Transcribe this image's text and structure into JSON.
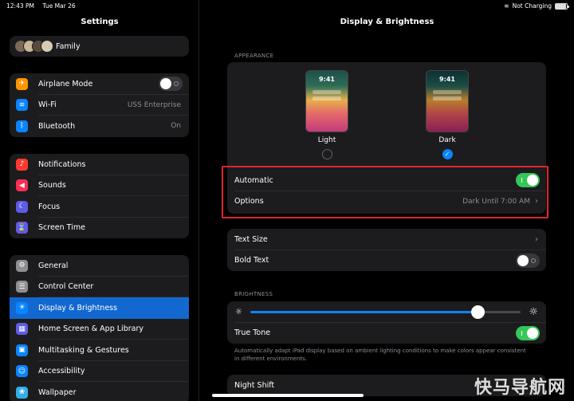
{
  "status": {
    "time": "12:43 PM",
    "date": "Tue Mar 26",
    "charging": "Not Charging",
    "battery_percent": 90
  },
  "sidebar": {
    "title": "Settings",
    "family": "Family",
    "group1": [
      {
        "label": "Airplane Mode",
        "icon": "airplane-icon",
        "color": "#ff9500",
        "glyph": "✈"
      },
      {
        "label": "Wi-Fi",
        "value": "USS Enterprise",
        "icon": "wifi-icon",
        "color": "#0a84ff",
        "glyph": "≋"
      },
      {
        "label": "Bluetooth",
        "value": "On",
        "icon": "bluetooth-icon",
        "color": "#0a84ff",
        "glyph": "ᛒ"
      }
    ],
    "group2": [
      {
        "label": "Notifications",
        "icon": "bell-icon",
        "color": "#ff3b30",
        "glyph": "♪"
      },
      {
        "label": "Sounds",
        "icon": "speaker-icon",
        "color": "#ff2d55",
        "glyph": "◀"
      },
      {
        "label": "Focus",
        "icon": "moon-icon",
        "color": "#5e5ce6",
        "glyph": "☾"
      },
      {
        "label": "Screen Time",
        "icon": "hourglass-icon",
        "color": "#5e5ce6",
        "glyph": "⌛"
      }
    ],
    "group3": [
      {
        "label": "General",
        "icon": "gear-icon",
        "color": "#8e8e93",
        "glyph": "⚙"
      },
      {
        "label": "Control Center",
        "icon": "sliders-icon",
        "color": "#8e8e93",
        "glyph": "☰"
      },
      {
        "label": "Display & Brightness",
        "icon": "sun-icon",
        "color": "#0a84ff",
        "glyph": "☀",
        "selected": true
      },
      {
        "label": "Home Screen & App Library",
        "icon": "grid-icon",
        "color": "#5e5ce6",
        "glyph": "▦"
      },
      {
        "label": "Multitasking & Gestures",
        "icon": "multitask-icon",
        "color": "#0a84ff",
        "glyph": "▣"
      },
      {
        "label": "Accessibility",
        "icon": "accessibility-icon",
        "color": "#0a84ff",
        "glyph": "☺"
      },
      {
        "label": "Wallpaper",
        "icon": "flower-icon",
        "color": "#32ade6",
        "glyph": "❀"
      }
    ]
  },
  "main": {
    "title": "Display & Brightness",
    "appearance_label": "APPEARANCE",
    "light_label": "Light",
    "dark_label": "Dark",
    "preview_time": "9:41",
    "automatic_label": "Automatic",
    "options_label": "Options",
    "options_value": "Dark Until 7:00 AM",
    "text_size_label": "Text Size",
    "bold_text_label": "Bold Text",
    "brightness_label": "BRIGHTNESS",
    "brightness_level": 0.84,
    "true_tone_label": "True Tone",
    "true_tone_desc": "Automatically adapt iPad display based on ambient lighting conditions to make colors appear consistent in different environments.",
    "night_shift_label": "Night Shift"
  },
  "watermark": "快马导航网"
}
